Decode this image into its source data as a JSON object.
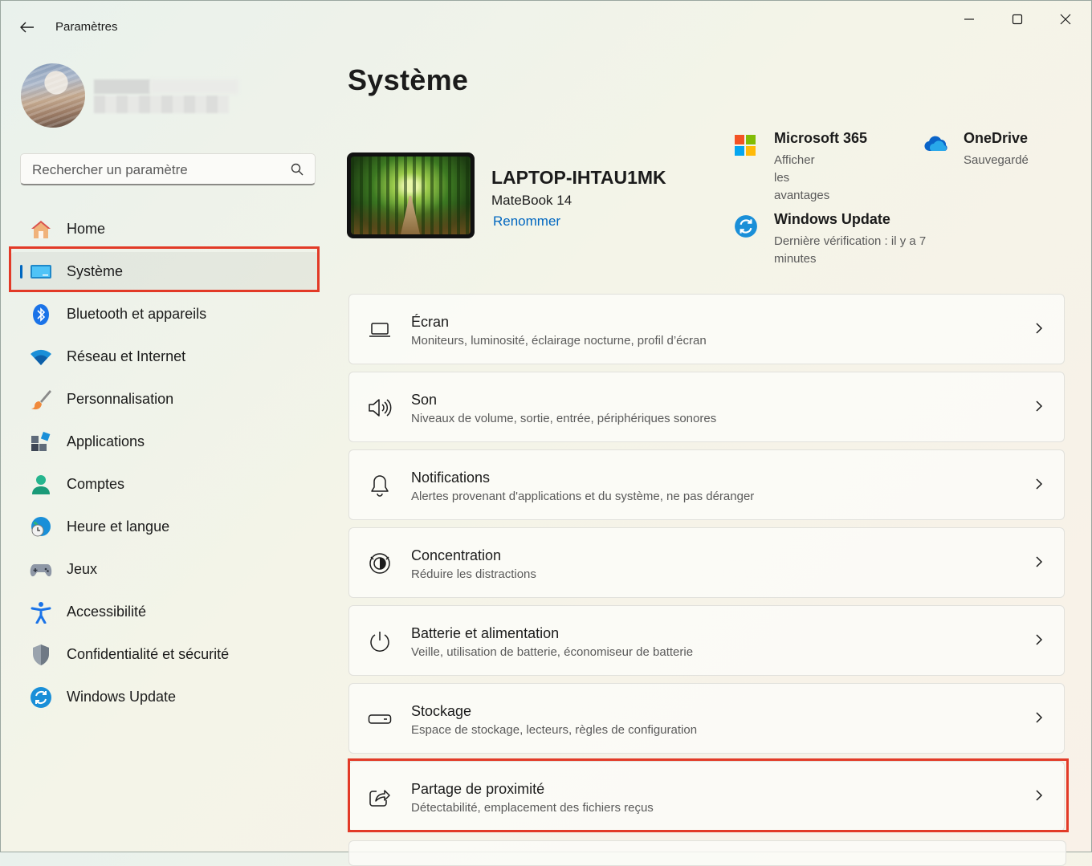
{
  "app": {
    "title": "Paramètres"
  },
  "search": {
    "placeholder": "Rechercher un paramètre"
  },
  "sidebar": {
    "items": [
      {
        "label": "Home",
        "name": "home"
      },
      {
        "label": "Système",
        "name": "systeme",
        "selected": true
      },
      {
        "label": "Bluetooth et appareils",
        "name": "bluetooth"
      },
      {
        "label": "Réseau et Internet",
        "name": "reseau"
      },
      {
        "label": "Personnalisation",
        "name": "personnalisation"
      },
      {
        "label": "Applications",
        "name": "applications"
      },
      {
        "label": "Comptes",
        "name": "comptes"
      },
      {
        "label": "Heure et langue",
        "name": "heure"
      },
      {
        "label": "Jeux",
        "name": "jeux"
      },
      {
        "label": "Accessibilité",
        "name": "accessibilite"
      },
      {
        "label": "Confidentialité et sécurité",
        "name": "confidentialite"
      },
      {
        "label": "Windows Update",
        "name": "windows-update"
      }
    ]
  },
  "main": {
    "title": "Système",
    "device": {
      "name": "LAPTOP-IHTAU1MK",
      "model": "MateBook 14",
      "rename": "Renommer"
    },
    "quick": {
      "m365": {
        "title": "Microsoft 365",
        "sub": "Afficher les avantages"
      },
      "onedrive": {
        "title": "OneDrive",
        "sub": "Sauvegardé"
      },
      "update": {
        "title": "Windows Update",
        "sub": "Dernière vérification : il y a 7 minutes"
      }
    },
    "cards": [
      {
        "title": "Écran",
        "sub": "Moniteurs, luminosité, éclairage nocturne, profil d’écran",
        "icon": "display-icon"
      },
      {
        "title": "Son",
        "sub": "Niveaux de volume, sortie, entrée, périphériques sonores",
        "icon": "speaker-icon"
      },
      {
        "title": "Notifications",
        "sub": "Alertes provenant d'applications et du système, ne pas déranger",
        "icon": "bell-icon"
      },
      {
        "title": "Concentration",
        "sub": "Réduire les distractions",
        "icon": "focus-icon"
      },
      {
        "title": "Batterie et alimentation",
        "sub": "Veille, utilisation de batterie, économiseur de batterie",
        "icon": "power-icon"
      },
      {
        "title": "Stockage",
        "sub": "Espace de stockage, lecteurs, règles de configuration",
        "icon": "storage-icon"
      },
      {
        "title": "Partage de proximité",
        "sub": "Détectabilité, emplacement des fichiers reçus",
        "icon": "share-icon"
      }
    ]
  },
  "colors": {
    "accent": "#0067c0",
    "highlight": "#e23a27"
  }
}
